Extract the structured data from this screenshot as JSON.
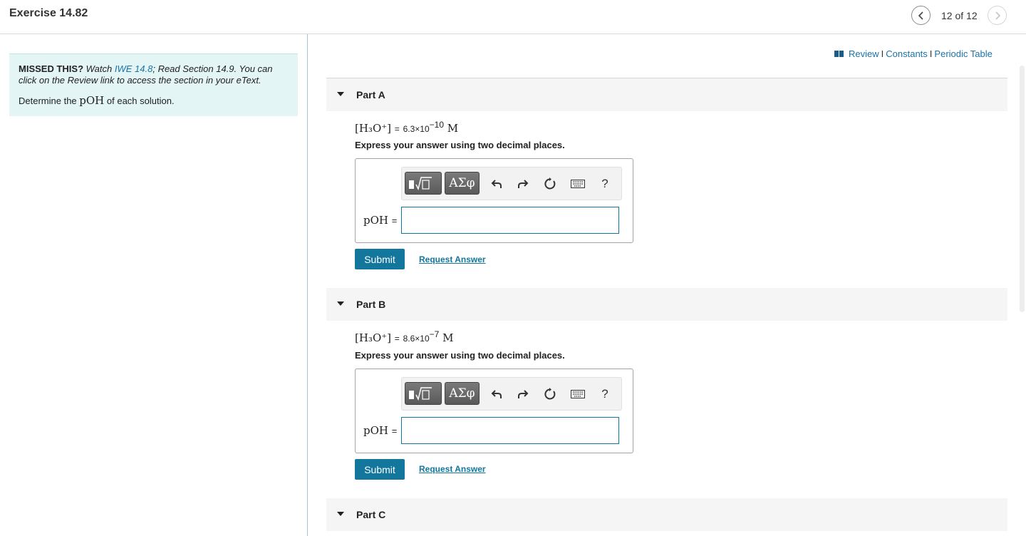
{
  "header": {
    "title": "Exercise 14.82",
    "counter": "12 of 12"
  },
  "sidebar": {
    "missed_label": "MISSED THIS?",
    "watch_text": "Watch",
    "iwe_link": "IWE 14.8",
    "read_text": "; Read Section 14.9. You can click on the Review link to access the section in your eText.",
    "determine_prefix": "Determine the",
    "determine_symbol": "pOH",
    "determine_suffix": "of each solution."
  },
  "resources": {
    "review": "Review",
    "constants": "Constants",
    "periodic_table": "Periodic Table",
    "separator": "I"
  },
  "parts": [
    {
      "title": "Part A",
      "species": "[H₃O⁺]",
      "eq": "=",
      "value": "6.3×10",
      "exponent": "−10",
      "unit": "M",
      "instruction": "Express your answer using two decimal places.",
      "answer_label": "pOH",
      "answer_eq": "=",
      "answer_value": "",
      "submit": "Submit",
      "request": "Request Answer"
    },
    {
      "title": "Part B",
      "species": "[H₃O⁺]",
      "eq": "=",
      "value": "8.6×10",
      "exponent": "−7",
      "unit": "M",
      "instruction": "Express your answer using two decimal places.",
      "answer_label": "pOH",
      "answer_eq": "=",
      "answer_value": "",
      "submit": "Submit",
      "request": "Request Answer"
    },
    {
      "title": "Part C"
    }
  ],
  "toolbar": {
    "greek_label": "ΑΣφ",
    "help_label": "?"
  },
  "icons": {
    "book": "book-icon",
    "prev": "chevron-left-icon",
    "next": "chevron-right-icon",
    "undo": "undo-icon",
    "redo": "redo-icon",
    "reset": "reset-icon",
    "keyboard": "keyboard-icon",
    "template": "templates-icon",
    "collapse": "collapse-triangle-icon"
  },
  "colors": {
    "accent": "#13769c",
    "link": "#1a73a8",
    "hint_bg": "#e4f5f5"
  }
}
